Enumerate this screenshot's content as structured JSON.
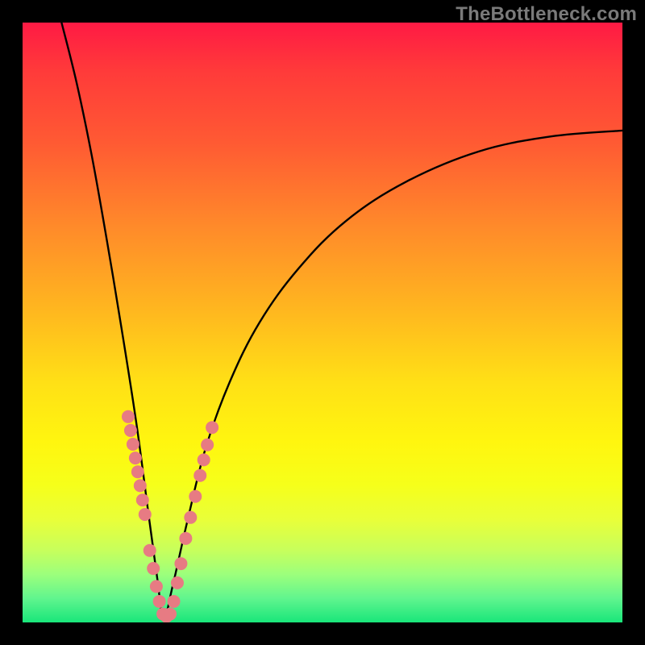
{
  "watermark": "TheBottleneck.com",
  "chart_data": {
    "type": "line",
    "title": "",
    "xlabel": "",
    "ylabel": "",
    "xlim": [
      0,
      1
    ],
    "ylim": [
      0,
      1
    ],
    "curve": {
      "name": "bottleneck-curve",
      "x0": 0.235,
      "left_top_y": 1.0,
      "left_top_x": 0.065,
      "right_end_x": 1.0,
      "right_end_y": 0.82,
      "points": [
        {
          "x": 0.065,
          "y": 1.0
        },
        {
          "x": 0.09,
          "y": 0.9
        },
        {
          "x": 0.115,
          "y": 0.78
        },
        {
          "x": 0.14,
          "y": 0.64
        },
        {
          "x": 0.165,
          "y": 0.49
        },
        {
          "x": 0.19,
          "y": 0.33
        },
        {
          "x": 0.21,
          "y": 0.18
        },
        {
          "x": 0.225,
          "y": 0.07
        },
        {
          "x": 0.235,
          "y": 0.005
        },
        {
          "x": 0.25,
          "y": 0.06
        },
        {
          "x": 0.275,
          "y": 0.17
        },
        {
          "x": 0.305,
          "y": 0.29
        },
        {
          "x": 0.345,
          "y": 0.4
        },
        {
          "x": 0.395,
          "y": 0.5
        },
        {
          "x": 0.46,
          "y": 0.59
        },
        {
          "x": 0.54,
          "y": 0.67
        },
        {
          "x": 0.64,
          "y": 0.735
        },
        {
          "x": 0.76,
          "y": 0.785
        },
        {
          "x": 0.88,
          "y": 0.81
        },
        {
          "x": 1.0,
          "y": 0.82
        }
      ]
    },
    "markers": {
      "name": "highlighted-points",
      "color": "#e77b83",
      "radius": 8,
      "points": [
        {
          "x": 0.176,
          "y": 0.343
        },
        {
          "x": 0.18,
          "y": 0.32
        },
        {
          "x": 0.184,
          "y": 0.297
        },
        {
          "x": 0.188,
          "y": 0.274
        },
        {
          "x": 0.192,
          "y": 0.251
        },
        {
          "x": 0.196,
          "y": 0.228
        },
        {
          "x": 0.2,
          "y": 0.204
        },
        {
          "x": 0.204,
          "y": 0.18
        },
        {
          "x": 0.212,
          "y": 0.12
        },
        {
          "x": 0.218,
          "y": 0.09
        },
        {
          "x": 0.223,
          "y": 0.06
        },
        {
          "x": 0.228,
          "y": 0.035
        },
        {
          "x": 0.234,
          "y": 0.014
        },
        {
          "x": 0.24,
          "y": 0.01
        },
        {
          "x": 0.246,
          "y": 0.014
        },
        {
          "x": 0.252,
          "y": 0.035
        },
        {
          "x": 0.258,
          "y": 0.066
        },
        {
          "x": 0.264,
          "y": 0.098
        },
        {
          "x": 0.272,
          "y": 0.14
        },
        {
          "x": 0.28,
          "y": 0.175
        },
        {
          "x": 0.288,
          "y": 0.21
        },
        {
          "x": 0.296,
          "y": 0.245
        },
        {
          "x": 0.302,
          "y": 0.271
        },
        {
          "x": 0.308,
          "y": 0.296
        },
        {
          "x": 0.316,
          "y": 0.325
        }
      ]
    }
  }
}
